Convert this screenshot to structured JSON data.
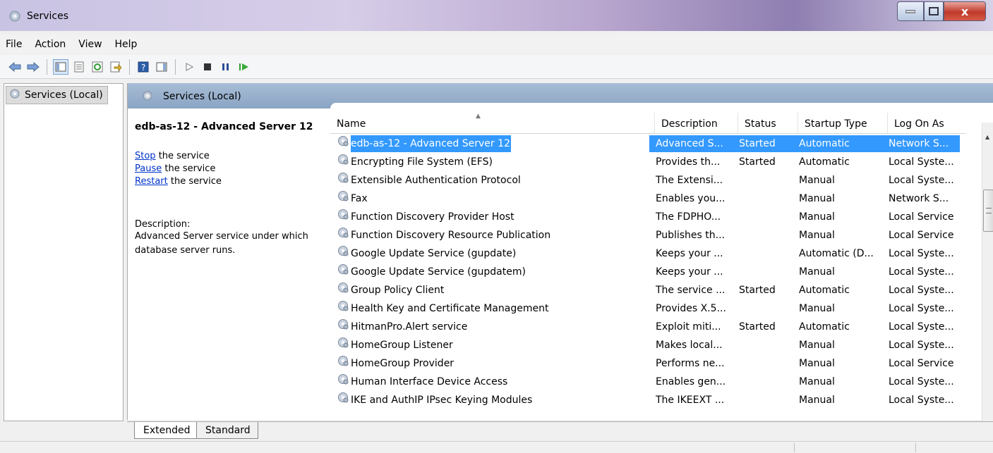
{
  "window": {
    "title": "Services",
    "close_glyph": "x"
  },
  "menu": {
    "items": [
      "File",
      "Action",
      "View",
      "Help"
    ]
  },
  "tree": {
    "root_label": "Services (Local)"
  },
  "main": {
    "header_title": "Services (Local)"
  },
  "details": {
    "selected_name": "edb-as-12 - Advanced Server 12",
    "stop_link": "Stop",
    "stop_text": " the service",
    "pause_link": "Pause",
    "pause_text": " the service",
    "restart_link": "Restart",
    "restart_text": " the service",
    "description_label": "Description:",
    "description_text": "Advanced Server service under which database server runs."
  },
  "columns": {
    "name": "Name",
    "description": "Description",
    "status": "Status",
    "startup_type": "Startup Type",
    "log_on_as": "Log On As"
  },
  "services": [
    {
      "name": "edb-as-12 - Advanced Server 12",
      "description": "Advanced S...",
      "status": "Started",
      "startup": "Automatic",
      "logon": "Network S...",
      "selected": true
    },
    {
      "name": "Encrypting File System (EFS)",
      "description": "Provides th...",
      "status": "Started",
      "startup": "Automatic",
      "logon": "Local Syste..."
    },
    {
      "name": "Extensible Authentication Protocol",
      "description": "The Extensi...",
      "status": "",
      "startup": "Manual",
      "logon": "Local Syste..."
    },
    {
      "name": "Fax",
      "description": "Enables you...",
      "status": "",
      "startup": "Manual",
      "logon": "Network S..."
    },
    {
      "name": "Function Discovery Provider Host",
      "description": "The FDPHO...",
      "status": "",
      "startup": "Manual",
      "logon": "Local Service"
    },
    {
      "name": "Function Discovery Resource Publication",
      "description": "Publishes th...",
      "status": "",
      "startup": "Manual",
      "logon": "Local Service"
    },
    {
      "name": "Google Update Service (gupdate)",
      "description": "Keeps your ...",
      "status": "",
      "startup": "Automatic (D...",
      "logon": "Local Syste..."
    },
    {
      "name": "Google Update Service (gupdatem)",
      "description": "Keeps your ...",
      "status": "",
      "startup": "Manual",
      "logon": "Local Syste..."
    },
    {
      "name": "Group Policy Client",
      "description": "The service ...",
      "status": "Started",
      "startup": "Automatic",
      "logon": "Local Syste..."
    },
    {
      "name": "Health Key and Certificate Management",
      "description": "Provides X.5...",
      "status": "",
      "startup": "Manual",
      "logon": "Local Syste..."
    },
    {
      "name": "HitmanPro.Alert service",
      "description": "Exploit miti...",
      "status": "Started",
      "startup": "Automatic",
      "logon": "Local Syste..."
    },
    {
      "name": "HomeGroup Listener",
      "description": "Makes local...",
      "status": "",
      "startup": "Manual",
      "logon": "Local Syste..."
    },
    {
      "name": "HomeGroup Provider",
      "description": "Performs ne...",
      "status": "",
      "startup": "Manual",
      "logon": "Local Service"
    },
    {
      "name": "Human Interface Device Access",
      "description": "Enables gen...",
      "status": "",
      "startup": "Manual",
      "logon": "Local Syste..."
    },
    {
      "name": "IKE and AuthIP IPsec Keying Modules",
      "description": "The IKEEXT ...",
      "status": "",
      "startup": "Manual",
      "logon": "Local Syste..."
    }
  ],
  "tabs": [
    "Extended",
    "Standard"
  ],
  "colors": {
    "selection": "#3399ff",
    "header": "#9db4d0",
    "link": "#0033cc"
  }
}
